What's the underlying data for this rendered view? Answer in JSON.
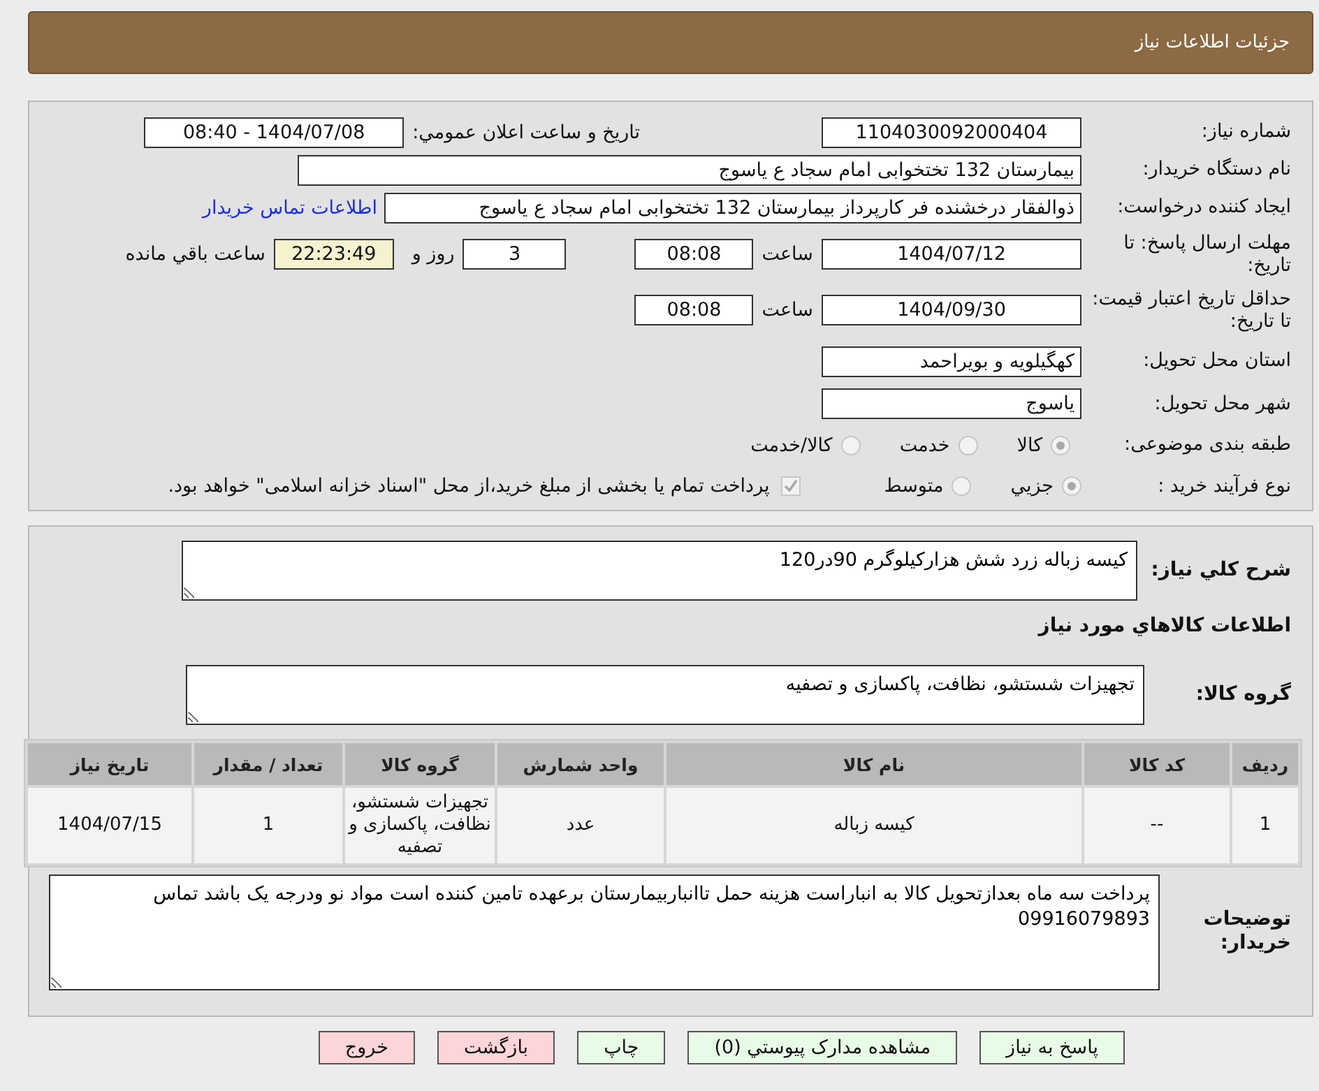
{
  "header": {
    "title": "جزئیات اطلاعات نیاز"
  },
  "fields": {
    "need_number": {
      "label": "شماره نیاز:",
      "value": "1104030092000404"
    },
    "announce": {
      "label": "تاریخ و ساعت اعلان عمومي:",
      "value": "1404/07/08 - 08:40"
    },
    "buyer": {
      "label": "نام دستگاه خریدار:",
      "value": "بیمارستان 132 تختخوابی امام سجاد  ع  یاسوج"
    },
    "creator": {
      "label": "ایجاد کننده درخواست:",
      "value": "ذوالفقار درخشنده فر کارپرداز بیمارستان 132 تختخوابی امام سجاد  ع  یاسوج",
      "link": "اطلاعات تماس خریدار"
    },
    "deadline": {
      "label": "مهلت ارسال پاسخ: تا تاریخ:",
      "date": "1404/07/12",
      "time_label": "ساعت",
      "time": "08:08",
      "days": "3",
      "days_label": "روز و",
      "remaining": "22:23:49",
      "remaining_label": "ساعت باقي مانده"
    },
    "validity": {
      "label": "حداقل تاریخ اعتبار قیمت: تا تاریخ:",
      "date": "1404/09/30",
      "time_label": "ساعت",
      "time": "08:08"
    },
    "province": {
      "label": "استان محل تحویل:",
      "value": "کهگیلویه و بویراحمد"
    },
    "city": {
      "label": "شهر محل تحویل:",
      "value": "یاسوج"
    },
    "category": {
      "label": "طبقه بندی موضوعی:",
      "options": [
        {
          "label": "کالا",
          "selected": true
        },
        {
          "label": "خدمت",
          "selected": false
        },
        {
          "label": "کالا/خدمت",
          "selected": false
        }
      ]
    },
    "purchase_type": {
      "label": "نوع فرآیند خرید :",
      "options": [
        {
          "label": "جزيي",
          "selected": true
        },
        {
          "label": "متوسط",
          "selected": false
        }
      ],
      "treasury": {
        "checked": true,
        "label": "پرداخت تمام یا بخشی از مبلغ خرید،از محل \"اسناد خزانه اسلامی\" خواهد بود."
      }
    }
  },
  "description": {
    "label": "شرح کلي نياز:",
    "value": "کیسه زباله زرد شش هزارکیلوگرم 90در120"
  },
  "goods_title": "اطلاعات کالاهاي مورد نياز",
  "goods_group": {
    "label": "گروه کالا:",
    "value": "تجهیزات شستشو، نظافت، پاکسازی و تصفیه"
  },
  "table": {
    "columns": [
      "ردیف",
      "کد کالا",
      "نام کالا",
      "واحد شمارش",
      "گروه کالا",
      "تعداد / مقدار",
      "تاریخ نیاز"
    ],
    "rows": [
      [
        "1",
        "--",
        "کیسه زباله",
        "عدد",
        "تجهیزات شستشو، نظافت، پاکسازی و تصفیه",
        "1",
        "1404/07/15"
      ]
    ]
  },
  "notes": {
    "label": "توضیحات خریدار:",
    "value": "پرداخت سه ماه بعدازتحویل کالا به انباراست هزینه حمل تاانباربیمارستان برعهده تامین کننده است مواد نو ودرجه یک باشد تماس 09916079893"
  },
  "buttons": [
    {
      "label": "پاسخ به نیاز",
      "kind": "normal"
    },
    {
      "label": "مشاهده مدارک پیوستي (0)",
      "kind": "normal"
    },
    {
      "label": "چاپ",
      "kind": "normal"
    },
    {
      "label": "بازگشت",
      "kind": "warn"
    },
    {
      "label": "خروج",
      "kind": "warn"
    }
  ]
}
